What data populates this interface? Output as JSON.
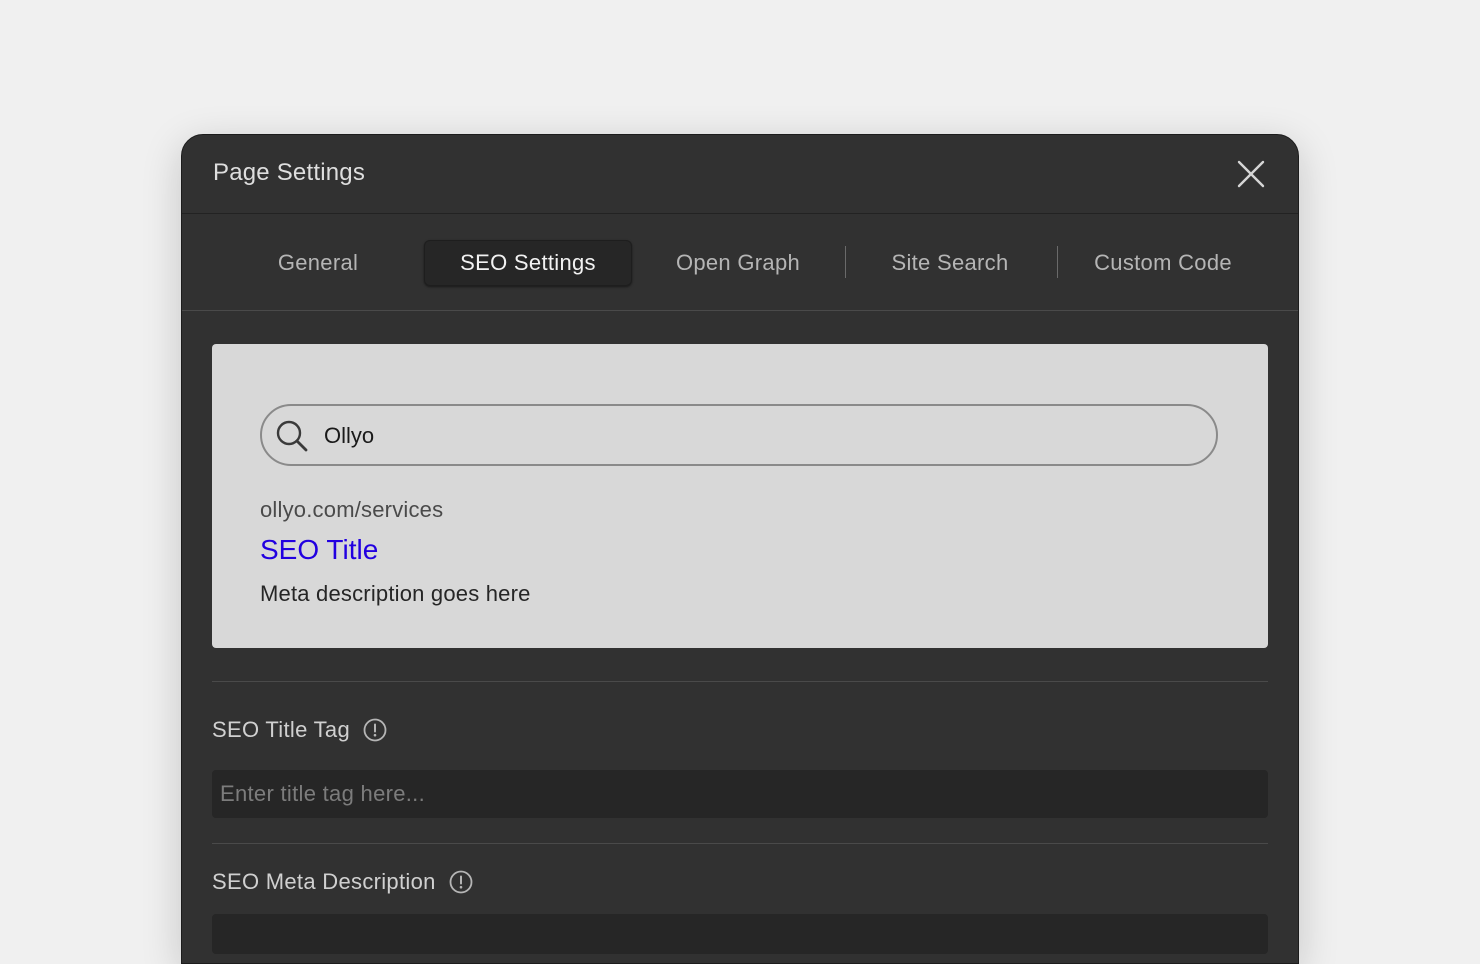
{
  "modal": {
    "title": "Page Settings"
  },
  "tabs": [
    {
      "label": "General",
      "active": false
    },
    {
      "label": "SEO Settings",
      "active": true
    },
    {
      "label": "Open Graph",
      "active": false
    },
    {
      "label": "Site Search",
      "active": false
    },
    {
      "label": "Custom Code",
      "active": false
    }
  ],
  "preview": {
    "search_query": "Ollyo",
    "url": "ollyo.com/services",
    "title": "SEO Title",
    "description": "Meta description goes here",
    "title_color": "#2200e0"
  },
  "fields": {
    "title_tag": {
      "label": "SEO Title Tag",
      "placeholder": "Enter title tag here..."
    },
    "meta_description": {
      "label": "SEO Meta Description"
    }
  },
  "icons": {
    "close": "close-icon",
    "search": "search-icon",
    "info": "info-icon"
  }
}
